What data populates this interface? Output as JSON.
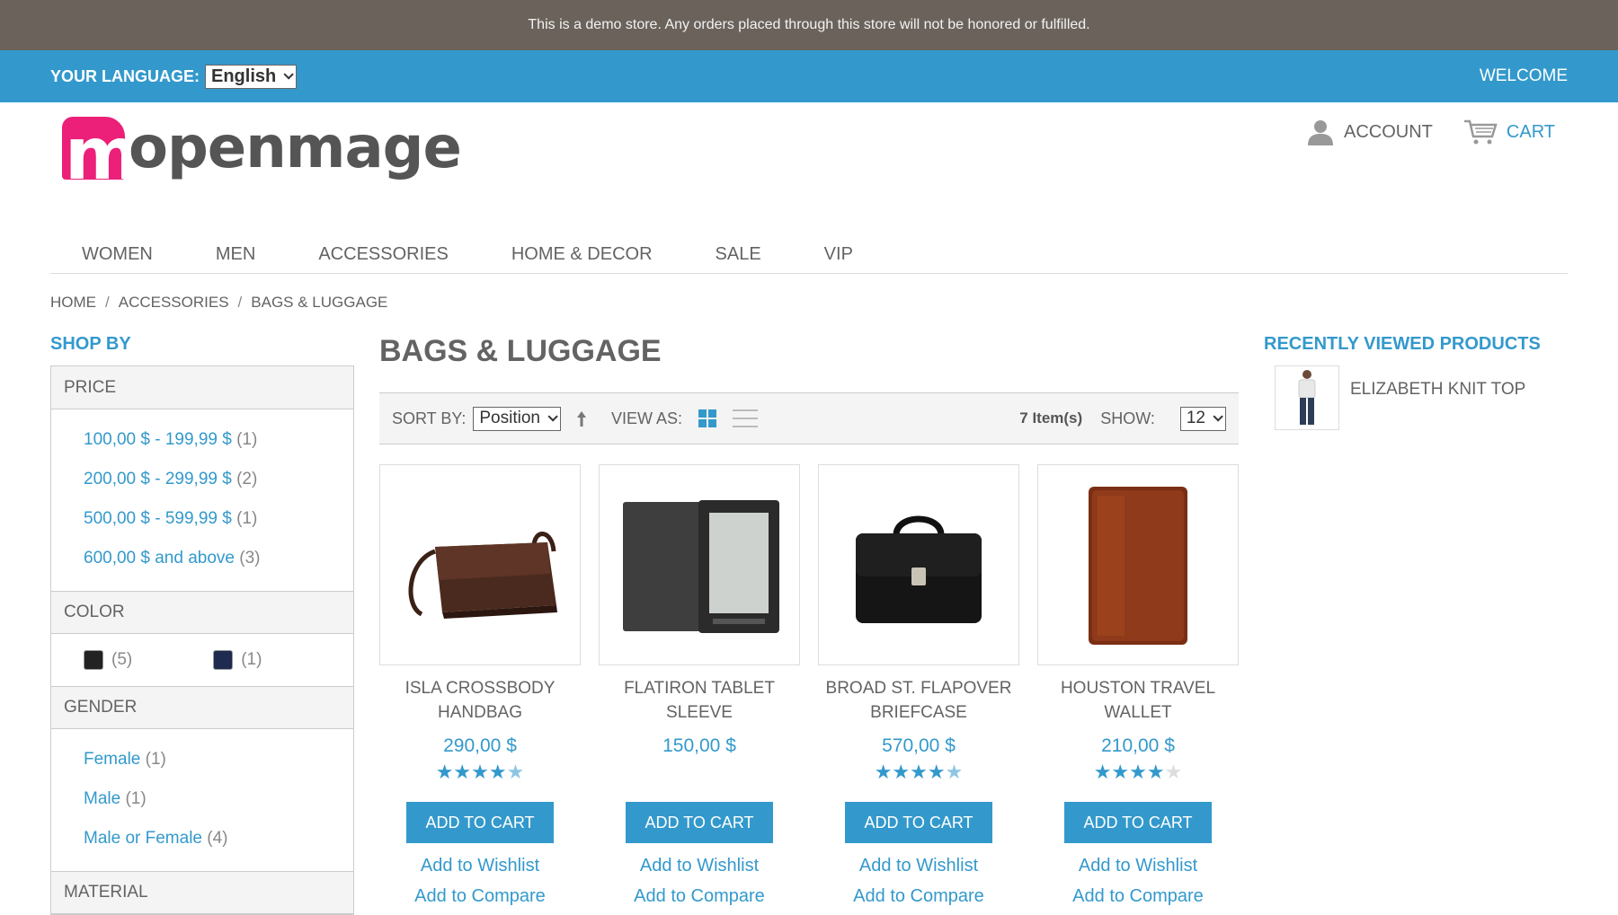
{
  "notice": "This is a demo store. Any orders placed through this store will not be honored or fulfilled.",
  "language": {
    "label": "YOUR LANGUAGE:",
    "value": "English"
  },
  "welcome": "WELCOME",
  "logo": {
    "mark": "m",
    "text": "openmage"
  },
  "header_links": {
    "account": "ACCOUNT",
    "cart": "CART"
  },
  "nav": [
    "WOMEN",
    "MEN",
    "ACCESSORIES",
    "HOME & DECOR",
    "SALE",
    "VIP"
  ],
  "breadcrumb": [
    "HOME",
    "ACCESSORIES",
    "BAGS & LUGGAGE"
  ],
  "breadcrumb_sep": "/",
  "sidebar": {
    "title": "SHOP BY",
    "price": {
      "label": "PRICE",
      "items": [
        {
          "label": "100,00 $ - 199,99 $",
          "count": "(1)"
        },
        {
          "label": "200,00 $ - 299,99 $",
          "count": "(2)"
        },
        {
          "label": "500,00 $ - 599,99 $",
          "count": "(1)"
        },
        {
          "label": "600,00 $ and above",
          "count": "(3)"
        }
      ]
    },
    "color": {
      "label": "COLOR",
      "items": [
        {
          "color": "#222222",
          "count": "(5)"
        },
        {
          "color": "#1e2a4f",
          "count": "(1)"
        }
      ]
    },
    "gender": {
      "label": "GENDER",
      "items": [
        {
          "label": "Female",
          "count": "(1)"
        },
        {
          "label": "Male",
          "count": "(1)"
        },
        {
          "label": "Male or Female",
          "count": "(4)"
        }
      ]
    },
    "material_label": "MATERIAL"
  },
  "page_title": "BAGS & LUGGAGE",
  "toolbar": {
    "sort_label": "SORT BY:",
    "sort_value": "Position",
    "view_label": "VIEW AS:",
    "count": "7 Item(s)",
    "show_label": "SHOW:",
    "show_value": "12"
  },
  "products": [
    {
      "name": "ISLA CROSSBODY HANDBAG",
      "price": "290,00 $",
      "rating_stars": 4.5,
      "add_to_cart": "ADD TO CART",
      "wishlist": "Add to Wishlist",
      "compare": "Add to Compare",
      "image": "crossbody-handbag"
    },
    {
      "name": "FLATIRON TABLET SLEEVE",
      "price": "150,00 $",
      "rating_stars": 0,
      "add_to_cart": "ADD TO CART",
      "wishlist": "Add to Wishlist",
      "compare": "Add to Compare",
      "image": "tablet-sleeve"
    },
    {
      "name": "BROAD ST. FLAPOVER BRIEFCASE",
      "price": "570,00 $",
      "rating_stars": 4.5,
      "add_to_cart": "ADD TO CART",
      "wishlist": "Add to Wishlist",
      "compare": "Add to Compare",
      "image": "briefcase"
    },
    {
      "name": "HOUSTON TRAVEL WALLET",
      "price": "210,00 $",
      "rating_stars": 4,
      "add_to_cart": "ADD TO CART",
      "wishlist": "Add to Wishlist",
      "compare": "Add to Compare",
      "image": "travel-wallet"
    }
  ],
  "recent": {
    "title": "RECENTLY VIEWED PRODUCTS",
    "items": [
      {
        "name": "ELIZABETH KNIT TOP"
      }
    ]
  },
  "colors": {
    "accent": "#3399cc",
    "notice_bg": "#6b635b",
    "brand_pink": "#ec1f79"
  }
}
